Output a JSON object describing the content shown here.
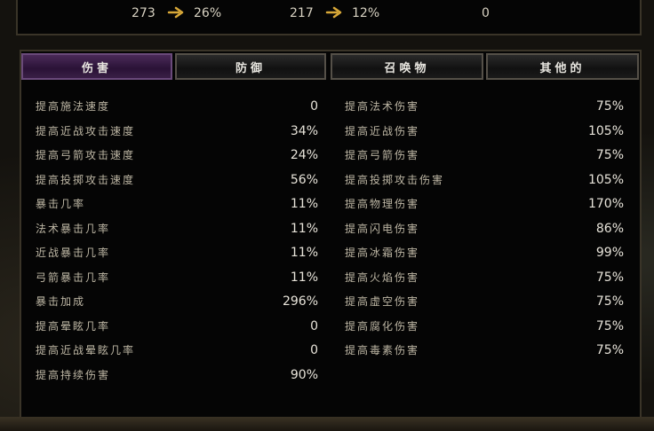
{
  "top_stats": [
    {
      "value": "273",
      "arrow_icon": "gold-arrow-icon",
      "percent": "26%"
    },
    {
      "value": "217",
      "arrow_icon": "gold-arrow-icon",
      "percent": "12%"
    },
    {
      "value": "0"
    }
  ],
  "tabs": [
    {
      "label": "伤害",
      "active": true
    },
    {
      "label": "防御",
      "active": false
    },
    {
      "label": "召唤物",
      "active": false
    },
    {
      "label": "其他的",
      "active": false
    }
  ],
  "left_stats": [
    {
      "label": "提高施法速度",
      "value": "0"
    },
    {
      "label": "提高近战攻击速度",
      "value": "34%"
    },
    {
      "label": "提高弓箭攻击速度",
      "value": "24%"
    },
    {
      "label": "提高投掷攻击速度",
      "value": "56%"
    },
    {
      "label": "暴击几率",
      "value": "11%"
    },
    {
      "label": "法术暴击几率",
      "value": "11%"
    },
    {
      "label": "近战暴击几率",
      "value": "11%"
    },
    {
      "label": "弓箭暴击几率",
      "value": "11%"
    },
    {
      "label": "暴击加成",
      "value": "296%"
    },
    {
      "label": "提高晕眩几率",
      "value": "0"
    },
    {
      "label": "提高近战晕眩几率",
      "value": "0"
    },
    {
      "label": "提高持续伤害",
      "value": "90%"
    }
  ],
  "right_stats": [
    {
      "label": "提高法术伤害",
      "value": "75%"
    },
    {
      "label": "提高近战伤害",
      "value": "105%"
    },
    {
      "label": "提高弓箭伤害",
      "value": "75%"
    },
    {
      "label": "提高投掷攻击伤害",
      "value": "105%"
    },
    {
      "label": "提高物理伤害",
      "value": "170%"
    },
    {
      "label": "提高闪电伤害",
      "value": "86%"
    },
    {
      "label": "提高冰霜伤害",
      "value": "99%"
    },
    {
      "label": "提高火焰伤害",
      "value": "75%"
    },
    {
      "label": "提高虚空伤害",
      "value": "75%"
    },
    {
      "label": "提高腐化伤害",
      "value": "75%"
    },
    {
      "label": "提高毒素伤害",
      "value": "75%"
    }
  ],
  "colors": {
    "accent_purple": "#4a2a58",
    "gold_arrow": "#d8a838",
    "text": "#e8e4da"
  }
}
